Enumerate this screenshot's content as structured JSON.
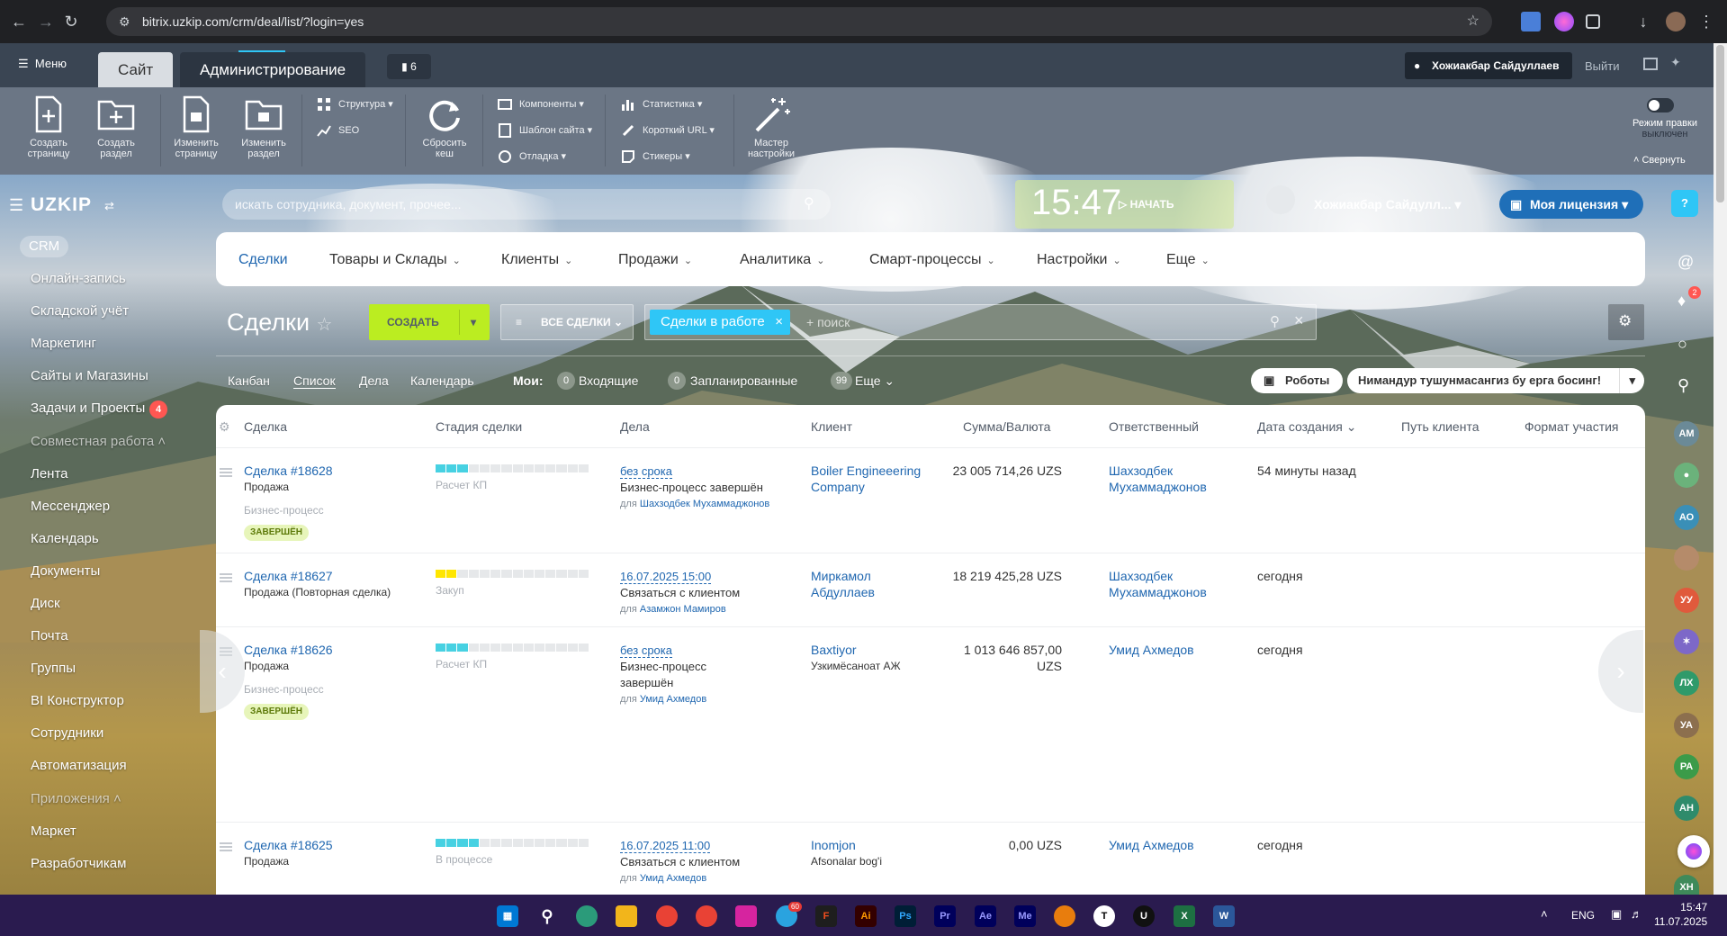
{
  "browser": {
    "url": "bitrix.uzkip.com/crm/deal/list/?login=yes"
  },
  "admin_bar": {
    "menu": "Меню",
    "tab_site": "Сайт",
    "tab_admin": "Администрирование",
    "notifications": "6",
    "user": "Хожиакбар Сайдуллаев",
    "logout": "Выйти"
  },
  "toolbar": {
    "create_page": "Создать страницу",
    "create_section": "Создать раздел",
    "edit_page": "Изменить страницу",
    "edit_section": "Изменить раздел",
    "structure": "Структура",
    "seo": "SEO",
    "reset_cache": "Сбросить кеш",
    "components": "Компоненты",
    "site_template": "Шаблон сайта",
    "debug": "Отладка",
    "statistics": "Статистика",
    "short_url": "Короткий URL",
    "stickers": "Стикеры",
    "wizard": "Мастер настройки",
    "edit_mode": "Режим правки",
    "edit_mode_state": "выключен",
    "collapse": "Свернуть"
  },
  "header": {
    "logo": "UZKIP",
    "search_placeholder": "искать сотрудника, документ, прочее...",
    "time": "15:47",
    "start": "НАЧАТЬ",
    "user": "Хожиакбар Сайдулл...",
    "license": "Моя лицензия"
  },
  "sidebar": {
    "items": [
      "CRM",
      "Онлайн-запись",
      "Складской учёт",
      "Маркетинг",
      "Сайты и Магазины",
      "Задачи и Проекты",
      "Совместная работа",
      "Лента",
      "Мессенджер",
      "Календарь",
      "Документы",
      "Диск",
      "Почта",
      "Группы",
      "BI Конструктор",
      "Сотрудники",
      "Автоматизация",
      "Приложения",
      "Маркет",
      "Разработчикам"
    ],
    "tasks_badge": "4"
  },
  "nav": {
    "items": [
      "Сделки",
      "Товары и Склады",
      "Клиенты",
      "Продажи",
      "Аналитика",
      "Смарт-процессы",
      "Настройки",
      "Еще"
    ]
  },
  "page": {
    "title": "Сделки",
    "create": "СОЗДАТЬ",
    "preset": "ВСЕ СДЕЛКИ",
    "filter_tag": "Сделки в работе",
    "search_placeholder": "+ поиск"
  },
  "views": {
    "kanban": "Канбан",
    "list": "Список",
    "tasks": "Дела",
    "calendar": "Календарь",
    "mine": "Мои:",
    "incoming_count": "0",
    "incoming": "Входящие",
    "planned_count": "0",
    "planned": "Запланированные",
    "more_count": "99",
    "more": "Еще",
    "robots": "Роботы",
    "bp": "Нимандур тушунмасангиз бу ерга босинг!"
  },
  "grid": {
    "columns": [
      "Сделка",
      "Стадия сделки",
      "Дела",
      "Клиент",
      "Сумма/Валюта",
      "Ответственный",
      "Дата создания",
      "Путь клиента",
      "Формат участия"
    ],
    "rows": [
      {
        "deal": "Сделка #18628",
        "type": "Продажа",
        "bp": "Бизнес-процесс",
        "bp_status": "ЗАВЕРШЁН",
        "stage": "Расчет КП",
        "act_date": "без срока",
        "act_title": "Бизнес-процесс завершён",
        "act_for": "для",
        "act_user": "Шахзодбек Мухаммаджонов",
        "client": "Boiler Engineeering Company",
        "client_sub": "",
        "sum": "23 005 714,26 UZS",
        "resp": "Шахзодбек Мухаммаджонов",
        "created": "54 минуты назад"
      },
      {
        "deal": "Сделка #18627",
        "type": "Продажа (Повторная сделка)",
        "bp": "",
        "bp_status": "",
        "stage": "Закуп",
        "act_date": "16.07.2025 15:00",
        "act_title": "Связаться с клиентом",
        "act_for": "для",
        "act_user": "Азамжон Мамиров",
        "client": "Миркамол Абдуллаев",
        "client_sub": "",
        "sum": "18 219 425,28 UZS",
        "resp": "Шахзодбек Мухаммаджонов",
        "created": "сегодня"
      },
      {
        "deal": "Сделка #18626",
        "type": "Продажа",
        "bp": "Бизнес-процесс",
        "bp_status": "ЗАВЕРШЁН",
        "stage": "Расчет КП",
        "act_date": "без срока",
        "act_title": "Бизнес-процесс завершён",
        "act_for": "для",
        "act_user": "Умид Ахмедов",
        "client": "Baxtiyor",
        "client_sub": "Узкимёсаноат АЖ",
        "sum": "1 013 646 857,00 UZS",
        "resp": "Умид Ахмедов",
        "created": "сегодня"
      },
      {
        "deal": "Сделка #18625",
        "type": "Продажа",
        "bp": "",
        "bp_status": "",
        "stage": "В процессе",
        "act_date": "16.07.2025 11:00",
        "act_title": "Связаться с клиентом",
        "act_for": "для",
        "act_user": "Умид Ахмедов",
        "client": "Inomjon",
        "client_sub": "Afsonalar bog'i",
        "sum": "0,00 UZS",
        "resp": "Умид Ахмедов",
        "created": "сегодня"
      }
    ]
  },
  "right_rail": {
    "avatars": [
      "АМ",
      "АО",
      "УУ",
      "ЛХ",
      "УА",
      "РА",
      "АН",
      "ХН"
    ],
    "notif": "2",
    "apps": "2"
  },
  "taskbar": {
    "lang": "ENG",
    "time": "15:47",
    "date": "11.07.2025",
    "tg_badge": "60"
  },
  "colors": {
    "accent": "#2fc6f6",
    "create": "#bbed21",
    "link": "#2067b0"
  }
}
